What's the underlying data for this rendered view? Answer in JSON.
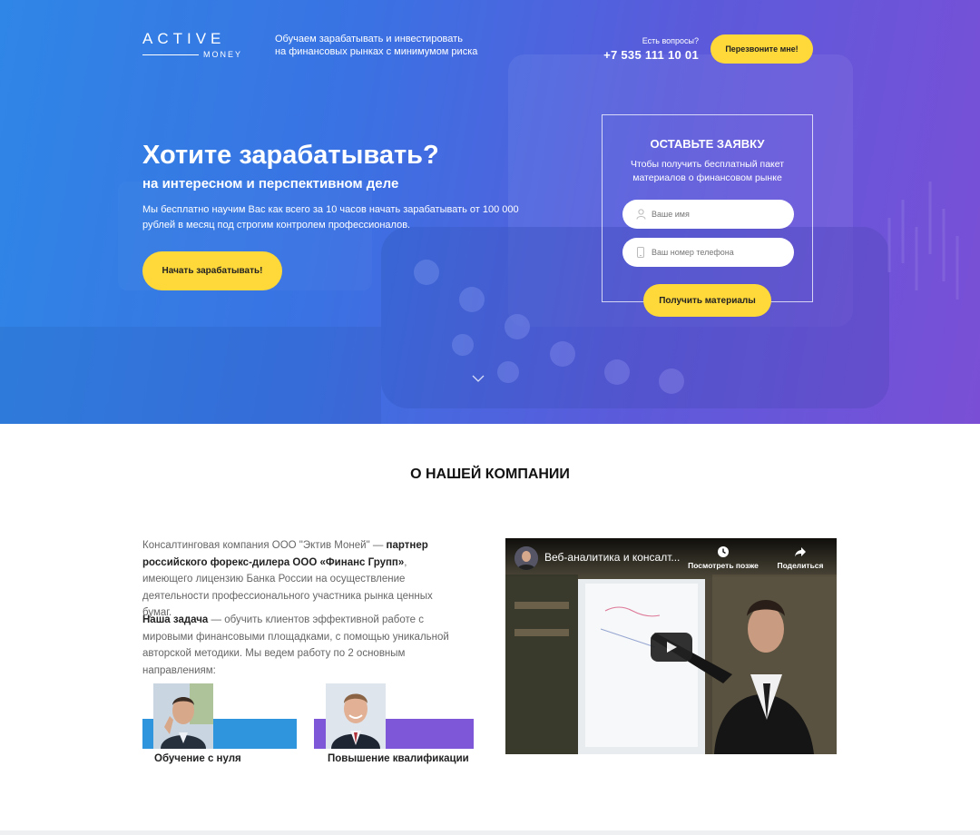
{
  "header": {
    "logo_top": "ACTIVE",
    "logo_bottom": "MONEY",
    "tagline_line1": "Обучаем зарабатывать и инвестировать",
    "tagline_line2": "на финансовых рынках с минимумом риска",
    "contact_question": "Есть вопросы?",
    "phone": "+7 535 111 10 01",
    "callback_label": "Перезвоните мне!"
  },
  "hero": {
    "title": "Хотите зарабатывать?",
    "subtitle": "на интересном и перспективном деле",
    "text": "Мы бесплатно научим Вас как всего за 10 часов начать зарабатывать от 100 000 рублей в месяц под строгим контролем профессионалов.",
    "start_label": "Начать зарабатывать!"
  },
  "form": {
    "title": "ОСТАВЬТЕ ЗАЯВКУ",
    "subtitle_line1": "Чтобы получить бесплатный пакет",
    "subtitle_line2": "материалов о финансовом рынке",
    "name_placeholder": "Ваше имя",
    "phone_placeholder": "Ваш номер телефона",
    "submit_label": "Получить материалы"
  },
  "about": {
    "title": "О НАШЕЙ КОМПАНИИ",
    "p1_a": "Консалтинговая компания ООО \"Эктив Моней\" — ",
    "p1_b": "партнер российского форекс-дилера ООО «Финанс Групп»",
    "p1_c": ", имеющего лицензию Банка России на осуществление деятельности профессионального участника рынка ценных бумаг.",
    "p2_a": "Наша задача",
    "p2_b": " — обучить клиентов эффективной работе с мировыми финансовыми площадками, с помощью уникальной авторской методики. Мы ведем работу по 2 основным направлениям:",
    "directions": [
      {
        "label": "Обучение с нуля"
      },
      {
        "label": "Повышение квалификации"
      }
    ]
  },
  "video": {
    "title": "Веб-аналитика и консалт...",
    "watch_later": "Посмотреть позже",
    "share": "Поделиться"
  },
  "colors": {
    "accent_yellow": "#ffd83a",
    "gradient_start": "#2f86e6",
    "gradient_end": "#7a4fd6",
    "direction_blue": "#2f95dc",
    "direction_purple": "#7e56d8"
  }
}
